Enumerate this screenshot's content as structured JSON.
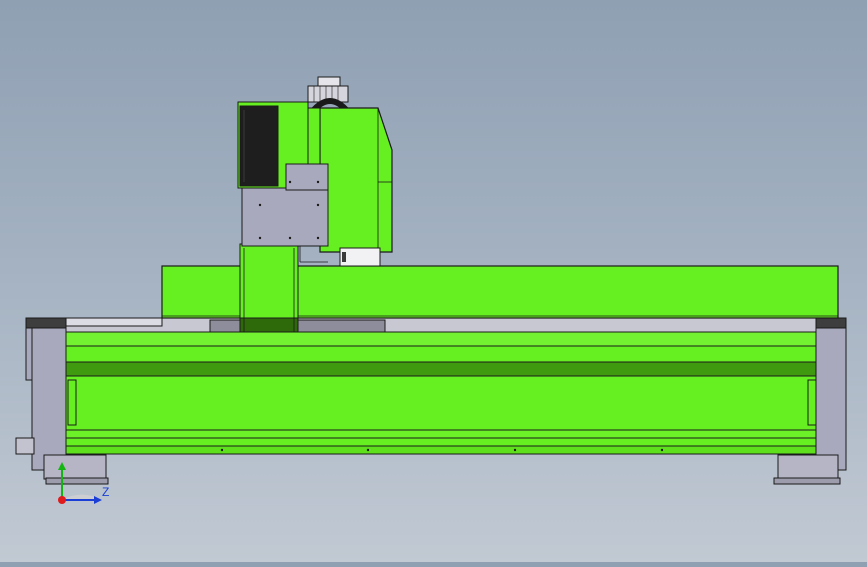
{
  "scene": {
    "background": "#9aa9ba",
    "machine_green": "#66f022",
    "machine_dark_green": "#3f9a10",
    "frame_grey": "#a9a9bd",
    "outline": "#1a1a1a"
  },
  "triad": {
    "z_label": "Z",
    "x_color": "#e01b1b",
    "y_color": "#13b513",
    "z_color": "#1b3fd6"
  }
}
